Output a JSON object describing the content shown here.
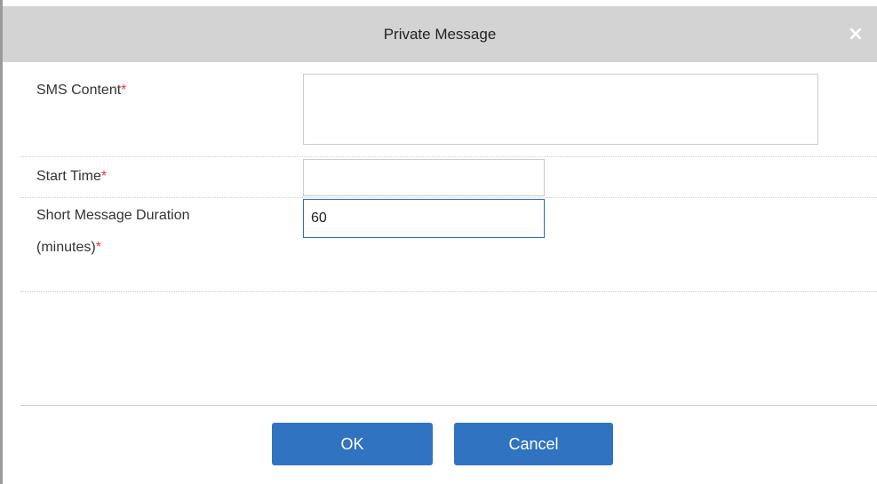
{
  "dialog": {
    "title": "Private Message",
    "close_glyph": "×",
    "close_icon": "close-icon"
  },
  "form": {
    "sms_content": {
      "label": "SMS Content",
      "required_mark": "*",
      "value": ""
    },
    "start_time": {
      "label": "Start Time",
      "required_mark": "*",
      "value": ""
    },
    "duration": {
      "label_line1": "Short Message Duration",
      "label_line2": "(minutes)",
      "required_mark": "*",
      "value": "60"
    }
  },
  "buttons": {
    "ok_label": "OK",
    "cancel_label": "Cancel"
  },
  "colors": {
    "primary_button": "#2f73c1",
    "titlebar": "#d3d3d3",
    "required": "#e53935",
    "focus_border": "#2a6fbf"
  }
}
